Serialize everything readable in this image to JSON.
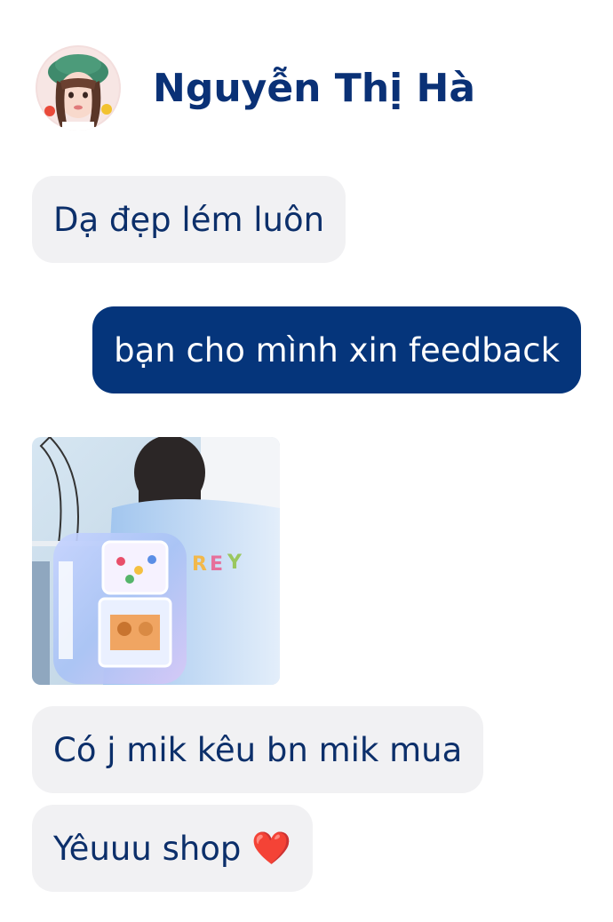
{
  "contact": {
    "name": "Nguyễn Thị Hà"
  },
  "messages": [
    {
      "direction": "incoming",
      "type": "text",
      "text": "Dạ đẹp lém luôn"
    },
    {
      "direction": "outgoing",
      "type": "text",
      "text": "bạn cho mình xin feedback"
    },
    {
      "direction": "incoming",
      "type": "image",
      "image": "photo-holographic-backpack"
    },
    {
      "direction": "incoming",
      "type": "text",
      "text": "Có j mik kêu bn mik mua"
    },
    {
      "direction": "incoming",
      "type": "text",
      "text": "Yêuuu shop",
      "emoji": "❤️"
    }
  ],
  "colors": {
    "incoming_bubble": "#f1f1f3",
    "incoming_text": "#0c2f6a",
    "outgoing_bubble": "#05357b",
    "outgoing_text": "#ffffff",
    "name": "#0a3176"
  }
}
